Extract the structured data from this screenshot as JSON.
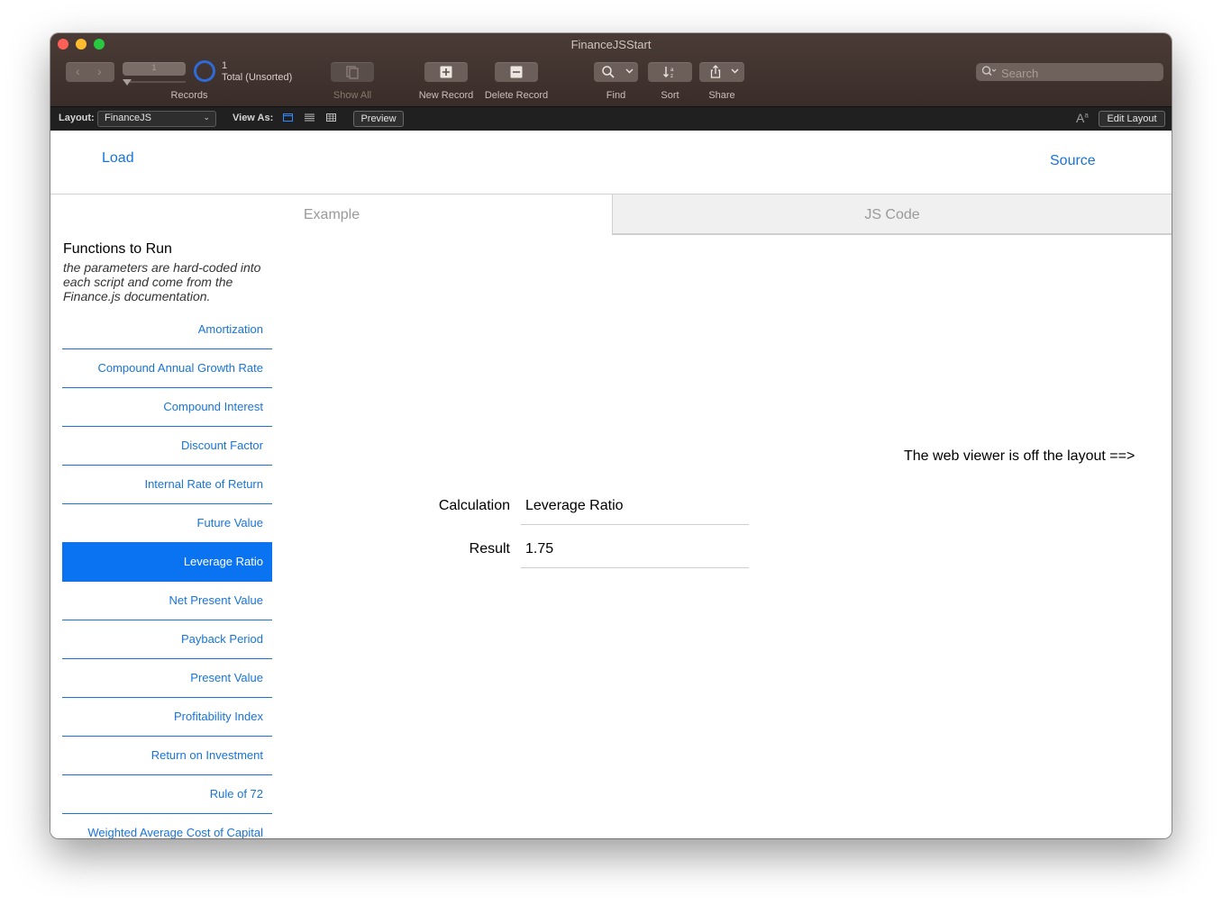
{
  "window": {
    "title": "FinanceJSStart"
  },
  "toolbar": {
    "record_number": "1",
    "records_label": "Records",
    "found_count": "1",
    "found_status": "Total (Unsorted)",
    "show_all": "Show All",
    "new_record": "New Record",
    "delete_record": "Delete Record",
    "find": "Find",
    "sort": "Sort",
    "share": "Share",
    "search_placeholder": "Search"
  },
  "layout_bar": {
    "layout_label": "Layout:",
    "layout_value": "FinanceJS",
    "view_as_label": "View As:",
    "preview": "Preview",
    "edit_layout": "Edit Layout"
  },
  "header": {
    "load": "Load",
    "source": "Source"
  },
  "tabs": [
    {
      "label": "Example",
      "active": true
    },
    {
      "label": "JS Code",
      "active": false
    }
  ],
  "functions": {
    "heading": "Functions to Run",
    "subtitle": "the parameters are hard-coded into each script and come from the Finance.js documentation.",
    "items": [
      {
        "label": "Amortization"
      },
      {
        "label": "Compound Annual Growth Rate"
      },
      {
        "label": "Compound Interest"
      },
      {
        "label": "Discount Factor"
      },
      {
        "label": "Internal Rate of Return"
      },
      {
        "label": "Future Value"
      },
      {
        "label": "Leverage Ratio",
        "active": true
      },
      {
        "label": "Net Present Value"
      },
      {
        "label": "Payback Period"
      },
      {
        "label": "Present Value"
      },
      {
        "label": "Profitability Index"
      },
      {
        "label": "Return on Investment"
      },
      {
        "label": "Rule of 72"
      },
      {
        "label": "Weighted Average Cost of Capital"
      }
    ]
  },
  "fields": {
    "calculation_label": "Calculation",
    "calculation_value": "Leverage Ratio",
    "result_label": "Result",
    "result_value": "1.75"
  },
  "web_viewer_note": "The web viewer is off the layout ==>",
  "colors": {
    "accent": "#1874d8",
    "selected": "#0a73f1",
    "toolbar": "#3f312d"
  }
}
